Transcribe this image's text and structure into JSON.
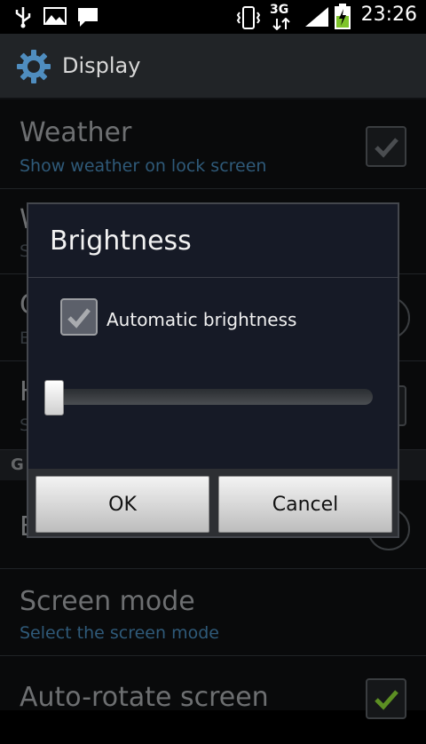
{
  "statusbar": {
    "time": "23:26",
    "network": "3G",
    "icons": [
      "usb-icon",
      "gallery-icon",
      "message-icon",
      "vibrate-icon",
      "signal-icon",
      "battery-charging-icon"
    ]
  },
  "actionbar": {
    "title": "Display",
    "icon": "gear-icon"
  },
  "settings": {
    "weather": {
      "title": "Weather",
      "subtitle": "Show weather on lock screen",
      "checked": true
    },
    "row2": {
      "title": "W",
      "subtitle": "S"
    },
    "row3": {
      "title": "C",
      "subtitle": "E"
    },
    "row4": {
      "title": "H",
      "subtitle": "S"
    },
    "section_label": "G",
    "row5": {
      "title": "B"
    },
    "screen_mode": {
      "title": "Screen mode",
      "subtitle": "Select the screen mode"
    },
    "auto_rotate": {
      "title": "Auto-rotate screen",
      "checked": true
    }
  },
  "dialog": {
    "title": "Brightness",
    "auto_label": "Automatic brightness",
    "auto_checked": true,
    "brightness_level": 0.0,
    "ok_label": "OK",
    "cancel_label": "Cancel"
  },
  "colors": {
    "accent": "#2f5a79",
    "dialog_bg": "#161a26",
    "check_green": "#7ec42b"
  }
}
